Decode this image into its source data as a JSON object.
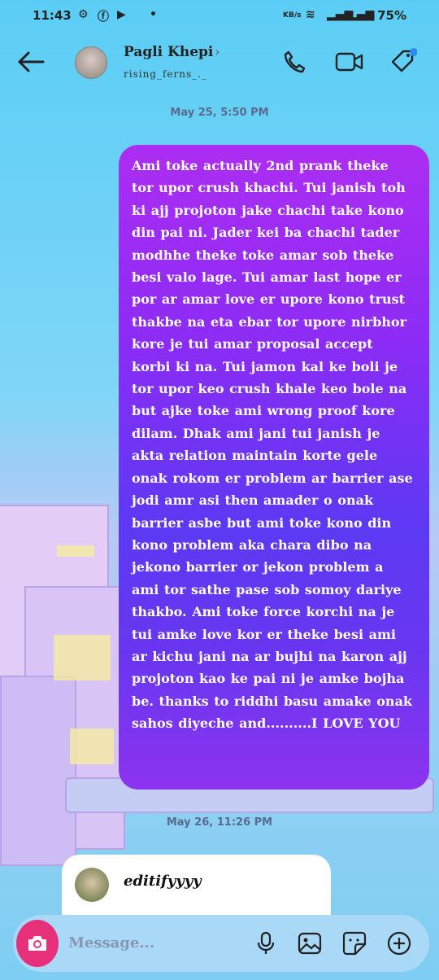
{
  "status_bar": {
    "time": "11:43",
    "network": "KB/s",
    "battery": "75%"
  },
  "header": {
    "name": "Pagli Khepi",
    "handle": "rising_ferns_._"
  },
  "timestamps": {
    "first": "May 25, 5:50 PM",
    "second": "May 26, 11:26 PM"
  },
  "message": {
    "text": "Ami toke actually 2nd prank theke tor upor crush khachi. Tui janish toh ki ajj projoton jake chachi take kono din pai ni. Jader kei ba chachi tader modhhe theke toke amar sob theke besi valo lage. Tui amar last hope er por ar amar love er upore kono trust thakbe na eta ebar tor upore nirbhor kore je tui amar proposal accept korbi ki na. Tui jamon kal ke boli je tor upor keo crush khale keo bole na but ajke toke ami wrong proof kore dilam. Dhak ami jani tui janish je akta relation maintain korte gele onak rokom er problem ar barrier ase jodi amr asi then amader o onak barrier asbe but ami toke kono din kono problem aka chara dibo na jekono barrier or jekon problem a ami tor sathe pase sob somoy dariye thakbo. Ami toke force korchi na je tui amke love kor er theke besi ami ar kichu jani na ar bujhi na karon ajj projoton kao ke pai ni je amke bojha be. thanks to riddhi basu amake onak sahos diyeche and..........I LOVE YOU"
  },
  "reply": {
    "text": "editifyyyy"
  },
  "composer": {
    "placeholder": "Message..."
  },
  "colors": {
    "bubble_top": "#ad2df2",
    "bubble_mid": "#5c39f3",
    "camera_button": "#e6317a",
    "notification_dot": "#2d8cf0"
  },
  "icons": {
    "back": "back-arrow-icon",
    "call": "phone-icon",
    "video": "video-icon",
    "tag": "tag-icon",
    "camera": "camera-icon",
    "mic": "microphone-icon",
    "gallery": "gallery-icon",
    "sticker": "sticker-icon",
    "more": "plus-circle-icon"
  }
}
